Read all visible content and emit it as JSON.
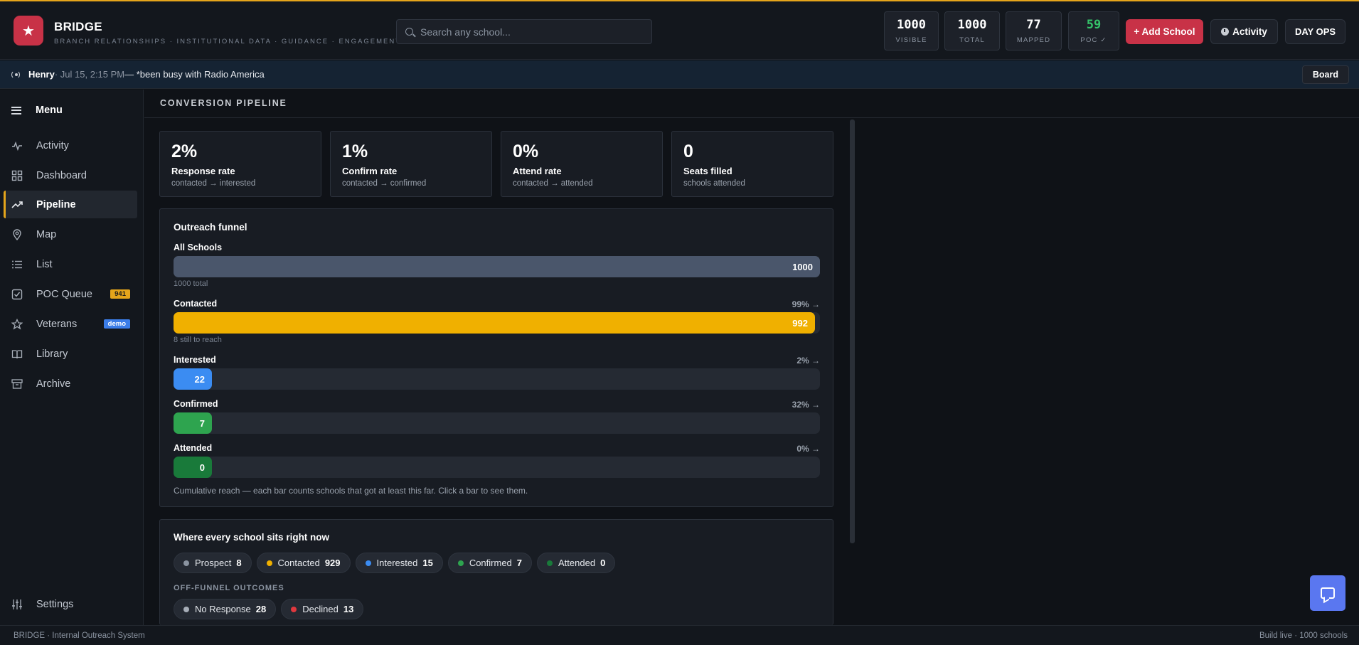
{
  "header": {
    "brand_title": "BRIDGE",
    "brand_subtitle": "BRANCH RELATIONSHIPS · INSTITUTIONAL DATA · GUIDANCE · ENGAGEMENT",
    "search_placeholder": "Search any school...",
    "stats": [
      {
        "value": "1000",
        "label": "VISIBLE"
      },
      {
        "value": "1000",
        "label": "TOTAL"
      },
      {
        "value": "77",
        "label": "MAPPED"
      },
      {
        "value": "59",
        "label": "POC ✓"
      }
    ],
    "add_school_label": "+ Add School",
    "activity_label": "Activity",
    "dayops_label": "DAY OPS"
  },
  "ticker": {
    "name": "Henry",
    "time": " · Jul 15, 2:15 PM ",
    "message": "— *been busy with Radio America",
    "board_label": "Board"
  },
  "sidebar": {
    "menu_label": "Menu",
    "items": [
      {
        "label": "Activity",
        "icon": "activity-icon"
      },
      {
        "label": "Dashboard",
        "icon": "grid-icon"
      },
      {
        "label": "Pipeline",
        "icon": "trending-icon",
        "active": true
      },
      {
        "label": "Map",
        "icon": "map-pin-icon"
      },
      {
        "label": "List",
        "icon": "list-icon"
      },
      {
        "label": "POC Queue",
        "icon": "check-square-icon",
        "badge": "941"
      },
      {
        "label": "Veterans",
        "icon": "star-icon",
        "badge": "demo"
      },
      {
        "label": "Library",
        "icon": "book-icon"
      },
      {
        "label": "Archive",
        "icon": "archive-icon"
      }
    ],
    "settings_label": "Settings"
  },
  "main": {
    "title": "CONVERSION PIPELINE",
    "kpis": [
      {
        "value": "2%",
        "label": "Response rate",
        "sub": "contacted → interested"
      },
      {
        "value": "1%",
        "label": "Confirm rate",
        "sub": "contacted → confirmed"
      },
      {
        "value": "0%",
        "label": "Attend rate",
        "sub": "contacted → attended"
      },
      {
        "value": "0",
        "label": "Seats filled",
        "sub": "schools attended"
      }
    ],
    "funnel": {
      "title": "Outreach funnel",
      "total": 1000,
      "stages": [
        {
          "label": "All Schools",
          "value": 1000,
          "pct": "",
          "note": "1000 total",
          "color": "#4a566b"
        },
        {
          "label": "Contacted",
          "value": 992,
          "pct": "99% →",
          "note": "8 still to reach",
          "color": "#f0b000"
        },
        {
          "label": "Interested",
          "value": 22,
          "pct": "2% →",
          "note": "",
          "color": "#3b8cf2"
        },
        {
          "label": "Confirmed",
          "value": 7,
          "pct": "32% →",
          "note": "",
          "color": "#2ea44f"
        },
        {
          "label": "Attended",
          "value": 0,
          "pct": "0% →",
          "note": "",
          "color": "#197a3a"
        }
      ],
      "footnote": "Cumulative reach — each bar counts schools that got at least this far. Click a bar to see them."
    },
    "status": {
      "title": "Where every school sits right now",
      "chips": [
        {
          "label": "Prospect",
          "count": "8",
          "color": "#8a93a0"
        },
        {
          "label": "Contacted",
          "count": "929",
          "color": "#f0b000"
        },
        {
          "label": "Interested",
          "count": "15",
          "color": "#3b8cf2"
        },
        {
          "label": "Confirmed",
          "count": "7",
          "color": "#2ea44f"
        },
        {
          "label": "Attended",
          "count": "0",
          "color": "#197a3a"
        }
      ],
      "off_funnel_label": "OFF-FUNNEL OUTCOMES",
      "off_chips": [
        {
          "label": "No Response",
          "count": "28",
          "color": "#a7aeb8"
        },
        {
          "label": "Declined",
          "count": "13",
          "color": "#e0383e"
        }
      ]
    }
  },
  "footer": {
    "left": "BRIDGE · Internal Outreach System",
    "right": "Build live · 1000 schools"
  }
}
